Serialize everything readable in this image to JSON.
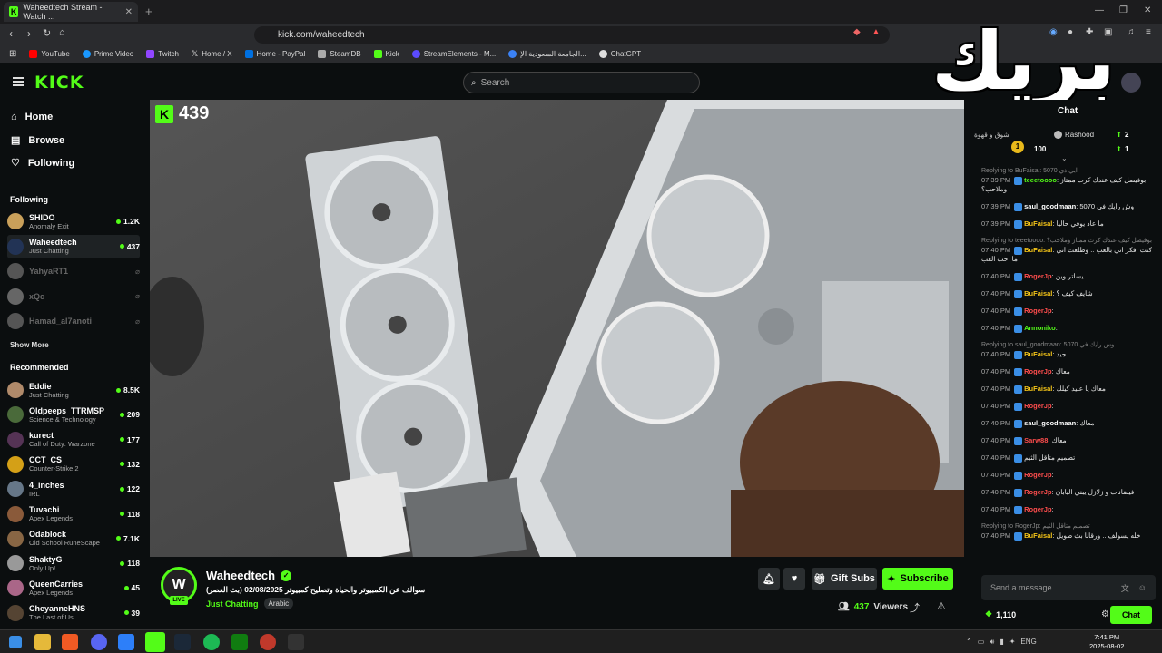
{
  "browser": {
    "tab_title": "Waheedtech Stream - Watch ...",
    "url": "kick.com/waheedtech",
    "bookmarks": [
      {
        "label": "YouTube",
        "color": "#ff0000"
      },
      {
        "label": "Prime Video",
        "color": "#1a98ff"
      },
      {
        "label": "Twitch",
        "color": "#9146ff"
      },
      {
        "label": "Home / X",
        "color": "#ffffff"
      },
      {
        "label": "Home - PayPal",
        "color": "#0070e0"
      },
      {
        "label": "SteamDB",
        "color": "#aaaaaa"
      },
      {
        "label": "Kick",
        "color": "#53fc18"
      },
      {
        "label": "StreamElements - M...",
        "color": "#5b4bff"
      },
      {
        "label": "الجامعة السعودية الإ...",
        "color": "#3b82f6"
      },
      {
        "label": "ChatGPT",
        "color": "#dddddd"
      }
    ]
  },
  "header": {
    "logo": "KICK",
    "search_placeholder": "Search",
    "overlay_text": "بريك"
  },
  "sidebar": {
    "nav": [
      "Home",
      "Browse",
      "Following"
    ],
    "following_title": "Following",
    "following": [
      {
        "name": "SHIDO",
        "category": "Anomaly Exit",
        "viewers": "1.2K",
        "avatar": "#c9a05a",
        "live": true
      },
      {
        "name": "Waheedtech",
        "category": "Just Chatting",
        "viewers": "437",
        "avatar": "#223355",
        "live": true
      },
      {
        "name": "YahyaRT1",
        "category": "",
        "viewers": "",
        "avatar": "#555555",
        "live": false
      },
      {
        "name": "xQc",
        "category": "",
        "viewers": "",
        "avatar": "#666666",
        "live": false
      },
      {
        "name": "Hamad_al7anoti",
        "category": "",
        "viewers": "",
        "avatar": "#555555",
        "live": false
      }
    ],
    "show_more": "Show More",
    "recommended_title": "Recommended",
    "recommended": [
      {
        "name": "Eddie",
        "category": "Just Chatting",
        "viewers": "8.5K",
        "avatar": "#b08a6a"
      },
      {
        "name": "Oldpeeps_TTRMSP",
        "category": "Science & Technology",
        "viewers": "209",
        "avatar": "#4a6a3a"
      },
      {
        "name": "kurect",
        "category": "Call of Duty: Warzone",
        "viewers": "177",
        "avatar": "#553355"
      },
      {
        "name": "CCT_CS",
        "category": "Counter-Strike 2",
        "viewers": "132",
        "avatar": "#d4a017"
      },
      {
        "name": "4_inches",
        "category": "IRL",
        "viewers": "122",
        "avatar": "#667788"
      },
      {
        "name": "Tuvachi",
        "category": "Apex Legends",
        "viewers": "118",
        "avatar": "#8a5a3a"
      },
      {
        "name": "Odablock",
        "category": "Old School RuneScape",
        "viewers": "7.1K",
        "avatar": "#886644"
      },
      {
        "name": "ShaktyG",
        "category": "Only Up!",
        "viewers": "118",
        "avatar": "#999999"
      },
      {
        "name": "QueenCarries",
        "category": "Apex Legends",
        "viewers": "45",
        "avatar": "#aa6688"
      },
      {
        "name": "CheyanneHNS",
        "category": "The Last of Us",
        "viewers": "39",
        "avatar": "#554433"
      }
    ]
  },
  "player": {
    "viewer_badge": "439"
  },
  "stream": {
    "streamer": "Waheedtech",
    "avatar_letter": "W",
    "live": "LIVE",
    "title": "سوالف عن الكمبيوتر والحياة وتصليح كمبيوتر 02/08/2025 (بث العصر)",
    "category": "Just Chatting",
    "tag": "Arabic",
    "gift_label": "Gift Subs",
    "follow_label": "Subscribe",
    "viewers": "437",
    "viewers_label": "Viewers"
  },
  "chat": {
    "title": "Chat",
    "pinned_text": "شوق و قهوة",
    "leaders": [
      {
        "name": "Rashood",
        "value": "2"
      },
      {
        "value": "100"
      },
      {
        "value": "1"
      }
    ],
    "messages": [
      {
        "reply": "Replying to BuFaisal: 5070 ابي ذي",
        "time": "07:39 PM",
        "user": "teeetoooo",
        "color": "#53fc18",
        "text": "بوفيصل كيف عندك كرت ممتاز وملاحب؟"
      },
      {
        "time": "07:39 PM",
        "user": "saul_goodmaan",
        "color": "#ffffff",
        "text": "5070 وش رايك في"
      },
      {
        "time": "07:39 PM",
        "user": "BuFaisal",
        "color": "#f5c518",
        "text": "ما عاد يوفي حاليا"
      },
      {
        "reply": "Replying to teeetoooo: بوفيصل كيف عندك كرت ممتاز وملاحب؟",
        "time": "07:40 PM",
        "user": "BuFaisal",
        "color": "#f5c518",
        "text": "كنت افكر اني بالعب .. وطلعت اني ما احب العب"
      },
      {
        "time": "07:40 PM",
        "user": "RogerJp",
        "color": "#ff4d4d",
        "text": "يساتر وين"
      },
      {
        "time": "07:40 PM",
        "user": "BuFaisal",
        "color": "#f5c518",
        "text": "شايف كيف ؟"
      },
      {
        "time": "07:40 PM",
        "user": "RogerJp",
        "color": "#ff4d4d",
        "text": ""
      },
      {
        "time": "07:40 PM",
        "user": "Annoniko",
        "color": "#53fc18",
        "text": ""
      },
      {
        "reply": "Replying to saul_goodmaan: 5070 وش رايك في",
        "time": "07:40 PM",
        "user": "BuFaisal",
        "color": "#f5c518",
        "text": "جيد"
      },
      {
        "time": "07:40 PM",
        "user": "RogerJp",
        "color": "#ff4d4d",
        "text": "معاك"
      },
      {
        "time": "07:40 PM",
        "user": "BuFaisal",
        "color": "#f5c518",
        "text": "معاك يا عبيد كيلك"
      },
      {
        "time": "07:40 PM",
        "user": "RogerJp",
        "color": "#ff4d4d",
        "text": ""
      },
      {
        "time": "07:40 PM",
        "user": "saul_goodmaan",
        "color": "#ffffff",
        "text": "معاك"
      },
      {
        "time": "07:40 PM",
        "user": "Sarw88",
        "color": "#ff4d4d",
        "text": "معاك"
      },
      {
        "time": "07:40 PM",
        "user": "",
        "color": "#ffffff",
        "text": "تصميم متاقل الثيم"
      },
      {
        "time": "07:40 PM",
        "user": "RogerJp",
        "color": "#ff4d4d",
        "text": ""
      },
      {
        "time": "07:40 PM",
        "user": "RogerJp",
        "color": "#ff4d4d",
        "text": "فيضانات و زلازل يبني اليابان"
      },
      {
        "time": "07:40 PM",
        "user": "RogerJp",
        "color": "#ff4d4d",
        "text": ""
      },
      {
        "reply": "Replying to RogerJp: تصميم متاقل الثيم",
        "time": "07:40 PM",
        "user": "BuFaisal",
        "color": "#f5c518",
        "text": "خله يسولف .. ورقانا بث طويل"
      }
    ],
    "input_placeholder": "Send a message",
    "points": "1,110",
    "chat_button": "Chat"
  },
  "taskbar": {
    "lang": "ENG",
    "time": "7:41 PM",
    "date": "2025-08-02"
  }
}
